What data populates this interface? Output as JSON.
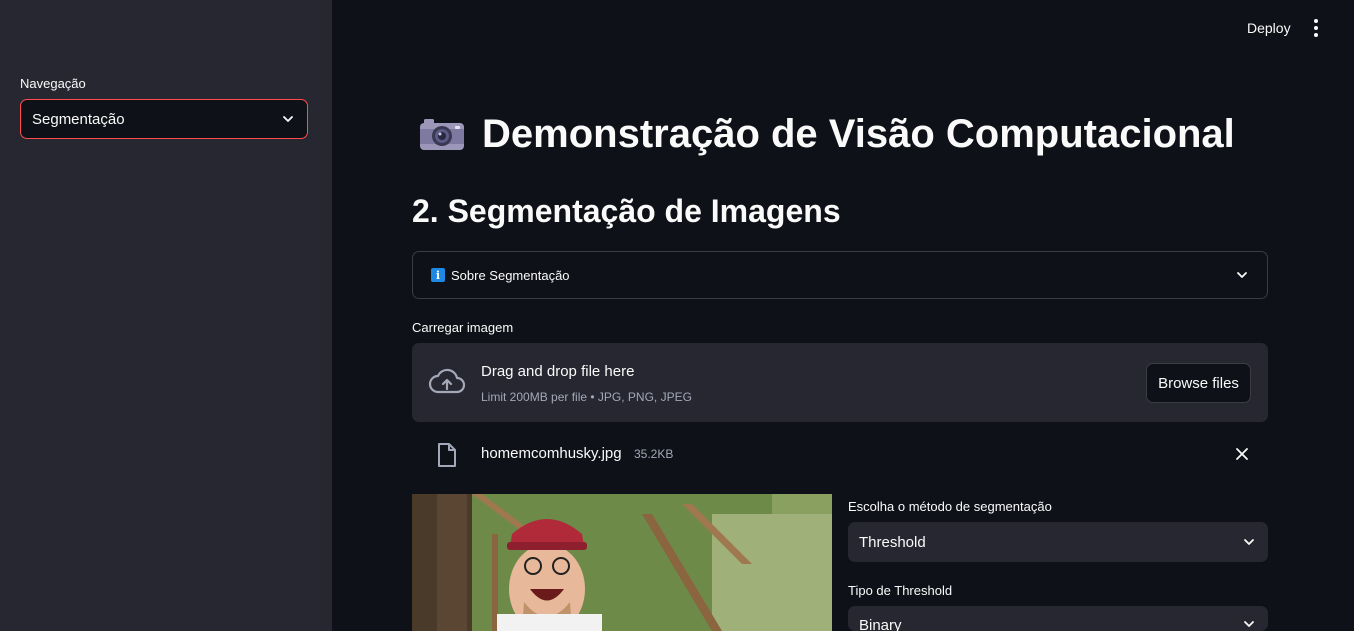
{
  "sidebar": {
    "nav_label": "Navegação",
    "nav_selected": "Segmentação"
  },
  "header": {
    "deploy_label": "Deploy",
    "menu_icon": "kebab-menu-icon"
  },
  "main": {
    "title_icon": "camera-icon",
    "title": "Demonstração de Visão Computacional",
    "section_title": "2. Segmentação de Imagens",
    "expander": {
      "icon": "info-icon",
      "label": "Sobre Segmentação"
    },
    "uploader": {
      "label": "Carregar imagem",
      "drop_title": "Drag and drop file here",
      "drop_sub": "Limit 200MB per file • JPG, PNG, JPEG",
      "browse_label": "Browse files"
    },
    "file": {
      "name": "homemcomhusky.jpg",
      "size": "35.2KB"
    },
    "controls": {
      "method_label": "Escolha o método de segmentação",
      "method_value": "Threshold",
      "type_label": "Tipo de Threshold",
      "type_value": "Binary"
    }
  },
  "colors": {
    "background": "#0e1117",
    "sidebar": "#262730",
    "accent": "#ff4b4b",
    "text": "#fafafa",
    "muted": "#a3a8b8"
  }
}
